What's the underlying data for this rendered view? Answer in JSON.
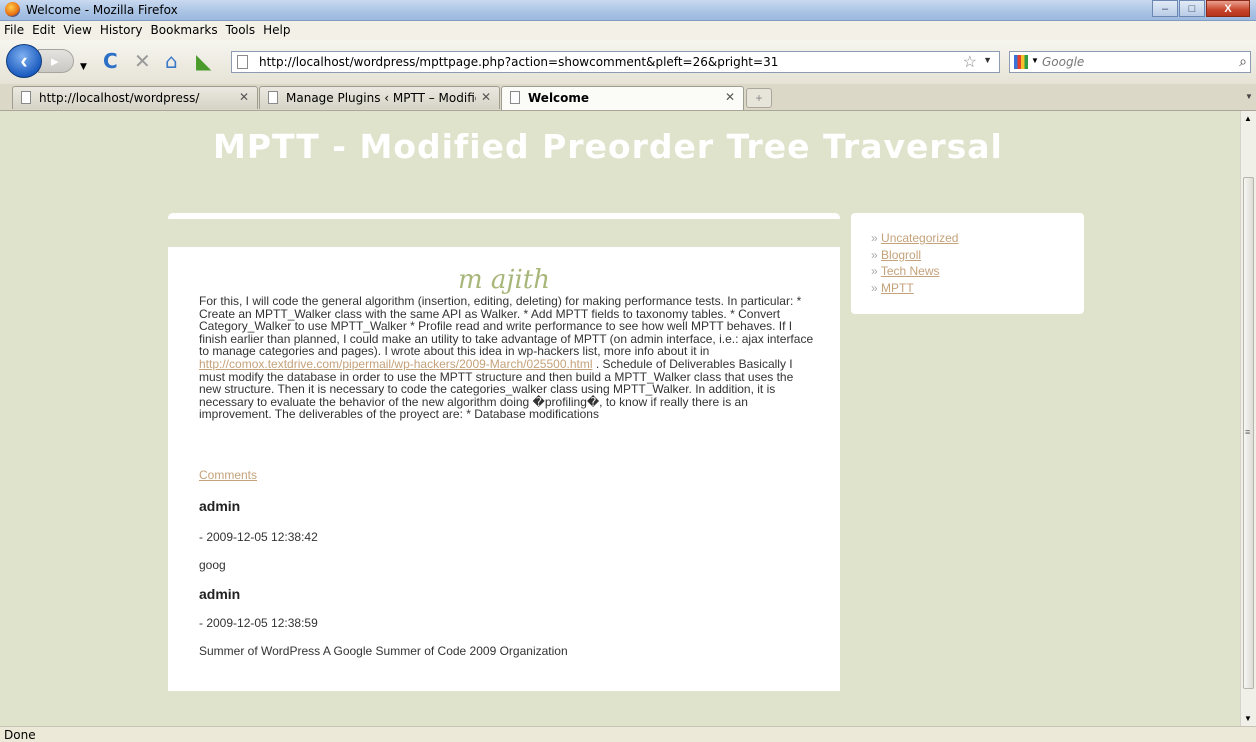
{
  "window": {
    "title": "Welcome - Mozilla Firefox",
    "min": "–",
    "max": "□",
    "close": "X"
  },
  "menu": [
    "File",
    "Edit",
    "View",
    "History",
    "Bookmarks",
    "Tools",
    "Help"
  ],
  "nav": {
    "url": "http://localhost/wordpress/mpttpage.php?action=showcomment&pleft=26&pright=31",
    "search_placeholder": "Google"
  },
  "tabs": [
    {
      "label": "http://localhost/wordpress/",
      "active": false
    },
    {
      "label": "Manage Plugins ‹ MPTT – Modified...",
      "active": false
    },
    {
      "label": "Welcome",
      "active": true
    }
  ],
  "site": {
    "title": "MPTT - Modified Preorder Tree Traversal"
  },
  "post": {
    "title": "m ajith",
    "body_before_link": "For this, I will code the general algorithm (insertion, editing, deleting) for making performance tests. In particular: * Create an MPTT_Walker class with the same API as Walker. * Add MPTT fields to taxonomy tables. * Convert Category_Walker to use MPTT_Walker * Profile read and write performance to see how well MPTT behaves. If I finish earlier than planned, I could make an utility to take advantage of MPTT (on admin interface, i.e.: ajax interface to manage categories and pages). I wrote about this idea in wp-hackers list, more info about it in",
    "link": "http://comox.textdrive.com/pipermail/wp-hackers/2009-March/025500.html",
    "body_after_link": ". Schedule of Deliverables Basically I must modify the database in order to use the MPTT structure and then build a MPTT_Walker class that uses the new structure. Then it is necessary to code the categories_walker class using MPTT_Walker. In addition, it is necessary to evaluate the behavior of the new algorithm doing �profiling�, to know if really there is an improvement. The deliverables of the proyect are: * Database modifications",
    "comments_link": "Comments",
    "comments": [
      {
        "author": "admin",
        "date": "- 2009-12-05 12:38:42",
        "text": "goog"
      },
      {
        "author": "admin",
        "date": "- 2009-12-05 12:38:59",
        "text": "Summer of WordPress A Google Summer of Code 2009 Organization"
      }
    ]
  },
  "sidebar": {
    "bullet": "»",
    "links": [
      "Uncategorized",
      "Blogroll",
      "Tech News",
      "MPTT"
    ]
  },
  "status": "Done"
}
